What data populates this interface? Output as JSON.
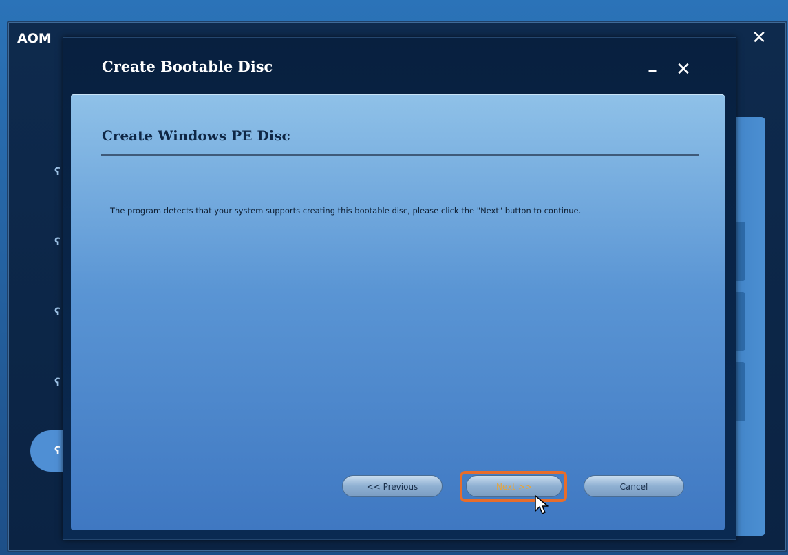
{
  "background_app": {
    "title": "AOM",
    "close_glyph": "✕"
  },
  "dialog": {
    "title": "Create Bootable Disc",
    "minimize_glyph": "–",
    "close_glyph": "✕"
  },
  "content": {
    "heading": "Create Windows PE Disc",
    "message": "The program detects that your system supports creating this bootable disc, please click the \"Next\" button to continue."
  },
  "buttons": {
    "previous": "<< Previous",
    "next": "Next >>",
    "cancel": "Cancel"
  },
  "colors": {
    "highlight": "#e86d2b",
    "next_text": "#e8a53a"
  },
  "icons": {
    "cursor": "mouse-pointer-icon"
  }
}
